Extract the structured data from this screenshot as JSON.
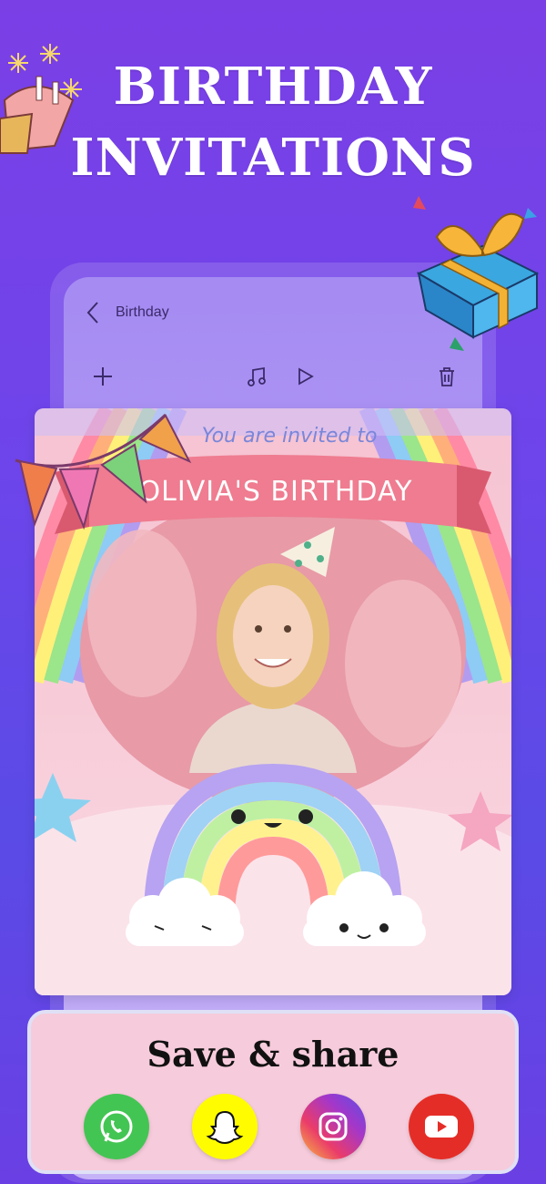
{
  "hero": {
    "line1": "BIRTHDAY",
    "line2": "INVITATIONS"
  },
  "editor": {
    "back_label": "Birthday",
    "toolbar": {
      "add_icon": "plus-icon",
      "music_icon": "music-note-icon",
      "play_icon": "play-icon",
      "delete_icon": "trash-icon"
    }
  },
  "card": {
    "invited_text": "You are invited to",
    "banner_text": "OLIVIA'S BIRTHDAY"
  },
  "share": {
    "title": "Save  & share",
    "apps": [
      "WhatsApp",
      "Snapchat",
      "Instagram",
      "YouTube"
    ]
  },
  "colors": {
    "background": "#6d45ea",
    "banner": "#ef7c90",
    "share_panel": "#f6cbdb",
    "whatsapp": "#43c553",
    "snapchat": "#fffc00",
    "youtube": "#e52d27"
  }
}
